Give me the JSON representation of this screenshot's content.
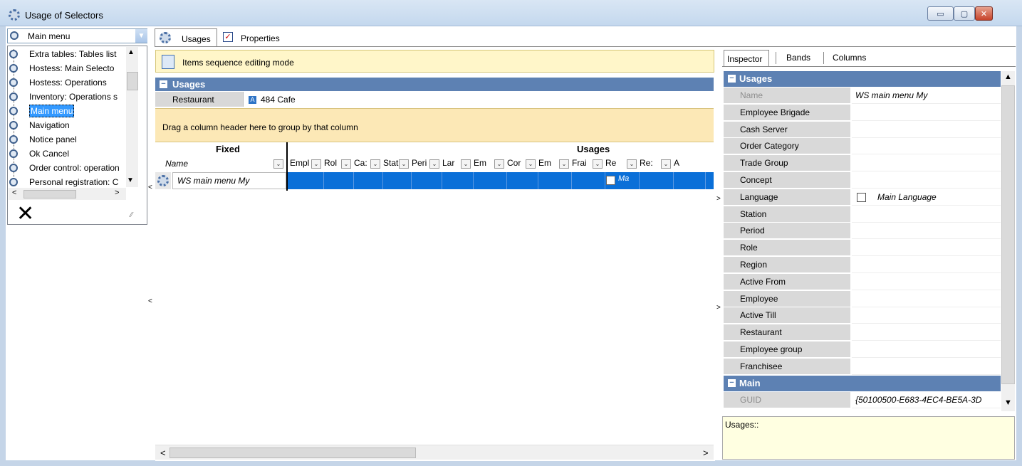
{
  "window": {
    "title": "Usage of Selectors",
    "min_label": "▭",
    "max_label": "▢",
    "close_label": "✕"
  },
  "selector": {
    "current": "Main menu",
    "items": [
      "Extra tables: Tables list",
      "Hostess: Main Selecto",
      "Hostess: Operations",
      "Inventory: Operations s",
      "Main menu",
      "Navigation",
      "Notice panel",
      "Ok Cancel",
      "Order control: operation",
      "Personal registration: C"
    ],
    "selected_index": 4,
    "delete_label": "✕"
  },
  "tabs": {
    "usages": "Usages",
    "properties": "Properties"
  },
  "center": {
    "seq_mode": "Items sequence editing mode",
    "usages_header": "Usages",
    "restaurant_label": "Restaurant",
    "restaurant_value": "484 Cafe",
    "restaurant_icon": "A",
    "group_hint": "Drag a column header here to group by that column",
    "band_fixed": "Fixed",
    "band_usages": "Usages",
    "name_col": "Name",
    "columns": [
      "Empl",
      "Rol",
      "Ca:",
      "Stati",
      "Peri",
      "Lar",
      "Em",
      "Cor",
      "Em",
      "Frai",
      "Re",
      "Re:",
      "A"
    ],
    "row_name": "WS main menu My",
    "row_lang_abbrev": "Ma"
  },
  "inspector": {
    "tabs": [
      "Inspector",
      "Bands",
      "Columns"
    ],
    "group_usages": "Usages",
    "group_main": "Main",
    "properties": [
      {
        "name": "Name",
        "value": "WS main menu My",
        "disabled": true
      },
      {
        "name": "Employee Brigade",
        "value": ""
      },
      {
        "name": "Cash Server",
        "value": ""
      },
      {
        "name": "Order Category",
        "value": ""
      },
      {
        "name": "Trade Group",
        "value": ""
      },
      {
        "name": "Concept",
        "value": ""
      },
      {
        "name": "Language",
        "value": "Main Language"
      },
      {
        "name": "Station",
        "value": ""
      },
      {
        "name": "Period",
        "value": ""
      },
      {
        "name": "Role",
        "value": ""
      },
      {
        "name": "Region",
        "value": ""
      },
      {
        "name": "Active From",
        "value": ""
      },
      {
        "name": "Employee",
        "value": ""
      },
      {
        "name": "Active Till",
        "value": ""
      },
      {
        "name": "Restaurant",
        "value": ""
      },
      {
        "name": "Employee group",
        "value": ""
      },
      {
        "name": "Franchisee",
        "value": ""
      }
    ],
    "main_properties": [
      {
        "name": "GUID",
        "value": "{50100500-E683-4EC4-BE5A-3D",
        "disabled": true
      }
    ],
    "description": "Usages::"
  }
}
